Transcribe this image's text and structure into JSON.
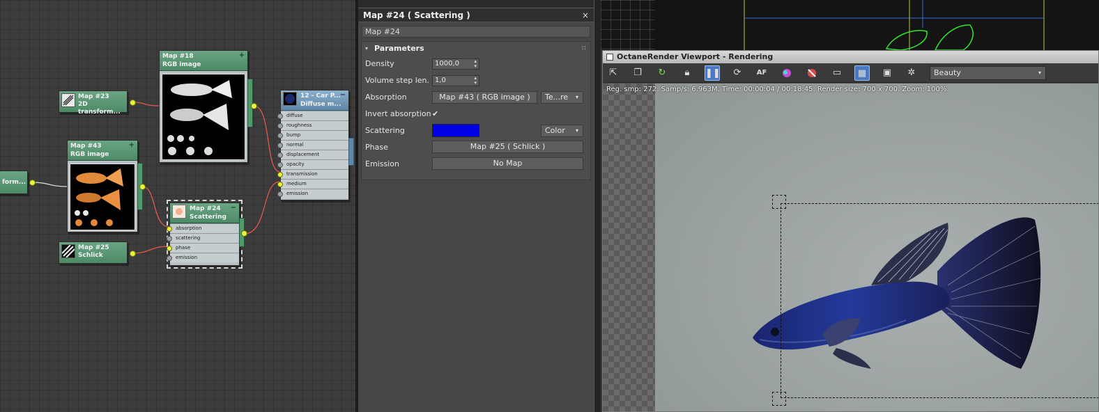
{
  "node_editor": {
    "nodes": {
      "map18": {
        "title": "Map #18",
        "subtitle": "RGB image",
        "pin": "+"
      },
      "map23": {
        "title": "Map #23",
        "subtitle": "2D transform..."
      },
      "map43": {
        "title": "Map #43",
        "subtitle": "RGB image",
        "pin": "+"
      },
      "map24": {
        "title": "Map #24",
        "subtitle": "Scattering",
        "pin": "−",
        "slots": [
          "absorption",
          "scattering",
          "phase",
          "emission"
        ]
      },
      "map25": {
        "title": "Map #25",
        "subtitle": "Schlick"
      },
      "material": {
        "title": "12 - Car P...",
        "subtitle": "Diffuse m...",
        "pin": "−",
        "slots": [
          "diffuse",
          "roughness",
          "bump",
          "normal",
          "displacement",
          "opacity",
          "transmission",
          "medium",
          "emission"
        ]
      },
      "offscreen": {
        "title": "",
        "subtitle": "form..."
      }
    }
  },
  "panel": {
    "title": "Map #24  ( Scattering )",
    "close": "×",
    "name_value": "Map #24",
    "rollout_title": "Parameters",
    "rollout_arrow": "▾",
    "rollout_grip": "∷",
    "params": {
      "density_label": "Density",
      "density_value": "1000,0",
      "volume_label": "Volume step len...",
      "volume_value": "1,0",
      "absorption_label": "Absorption",
      "absorption_map": "Map #43  ( RGB image )",
      "absorption_type": "Te...re",
      "invert_label": "Invert absorption",
      "invert_check": "✔",
      "scattering_label": "Scattering",
      "scattering_color": "#0000e6",
      "scattering_type": "Color",
      "phase_label": "Phase",
      "phase_map": "Map #25  ( Schlick )",
      "emission_label": "Emission",
      "emission_map": "No Map"
    },
    "caret": "▾",
    "spin_arrows": "▴▾"
  },
  "viewport": {
    "title": "OctaneRender Viewport - Rendering",
    "toolbar_icons": [
      "export-icon",
      "copy-icon",
      "refresh-icon",
      "lock-icon",
      "pause-icon",
      "restart-icon",
      "autofocus-icon",
      "color-icon",
      "clay-icon",
      "region-icon",
      "frame-icon",
      "render-region-icon",
      "settings-icon"
    ],
    "pass_select": "Beauty",
    "status": "Reg. smp: 272.   Samp/s: 6.963M.   Time: 00:00:04 / 00:18:45.   Render size: 700 x 700.   Zoom: 100%.",
    "af_label": "AF"
  },
  "colors": {
    "accent_blue": "#4a78c2",
    "wire": "#e05a4a",
    "pin_live": "#e8f53a",
    "fish_blue": "#1f2f8a"
  }
}
